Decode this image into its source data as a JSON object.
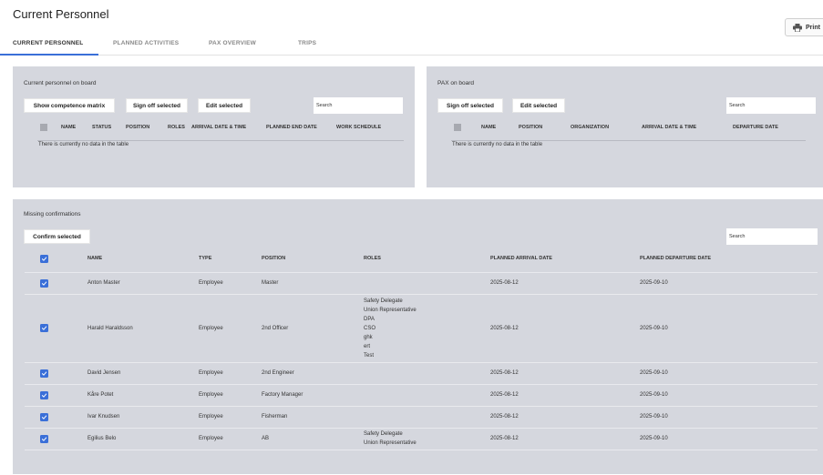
{
  "page": {
    "title": "Current Personnel",
    "print_label": "Print"
  },
  "tabs": [
    {
      "label": "CURRENT PERSONNEL"
    },
    {
      "label": "PLANNED ACTIVITIES"
    },
    {
      "label": "PAX OVERVIEW"
    },
    {
      "label": "TRIPS"
    }
  ],
  "personnel_panel": {
    "title": "Current personnel on board",
    "buttons": {
      "competence": "Show competence matrix",
      "sign_off": "Sign off selected",
      "edit": "Edit selected"
    },
    "search_placeholder": "Search",
    "columns": [
      "NAME",
      "STATUS",
      "POSITION",
      "ROLES",
      "ARRIVAL DATE & TIME",
      "PLANNED END DATE",
      "WORK SCHEDULE"
    ],
    "empty_message": "There is currently no data in the table"
  },
  "pax_panel": {
    "title": "PAX on board",
    "buttons": {
      "sign_off": "Sign off selected",
      "edit": "Edit selected"
    },
    "search_placeholder": "Search",
    "columns": [
      "NAME",
      "POSITION",
      "ORGANIZATION",
      "ARRIVAL DATE & TIME",
      "DEPARTURE DATE"
    ],
    "empty_message": "There is currently no data in the table"
  },
  "missing_panel": {
    "title": "Missing confirmations",
    "confirm_label": "Confirm selected",
    "search_placeholder": "Search",
    "columns": [
      "NAME",
      "TYPE",
      "POSITION",
      "ROLES",
      "PLANNED ARRIVAL DATE",
      "PLANNED DEPARTURE DATE"
    ],
    "rows": [
      {
        "name": "Anton Master",
        "type": "Employee",
        "position": "Master",
        "roles": [],
        "arrival": "2025-08-12",
        "departure": "2025-09-10"
      },
      {
        "name": "Harald Haraldsson",
        "type": "Employee",
        "position": "2nd Officer",
        "roles": [
          "Safety Delegate",
          "Union Representative",
          "DPA",
          "CSO",
          "ghk",
          "ert",
          "Test"
        ],
        "arrival": "2025-08-12",
        "departure": "2025-09-10"
      },
      {
        "name": "David Jensen",
        "type": "Employee",
        "position": "2nd Engineer",
        "roles": [],
        "arrival": "2025-08-12",
        "departure": "2025-09-10"
      },
      {
        "name": "Kåre Potet",
        "type": "Employee",
        "position": "Factory Manager",
        "roles": [],
        "arrival": "2025-08-12",
        "departure": "2025-09-10"
      },
      {
        "name": "Ivar Knudsen",
        "type": "Employee",
        "position": "Fisherman",
        "roles": [],
        "arrival": "2025-08-12",
        "departure": "2025-09-10"
      },
      {
        "name": "Egilius Belo",
        "type": "Employee",
        "position": "AB",
        "roles": [
          "Safety Delegate",
          "Union Representative"
        ],
        "arrival": "2025-08-12",
        "departure": "2025-09-10"
      }
    ]
  },
  "colors": {
    "accent": "#3a6fd8",
    "panel_bg": "#d5d7de"
  },
  "icons": {
    "print": "printer-icon",
    "check": "checkmark-icon"
  }
}
